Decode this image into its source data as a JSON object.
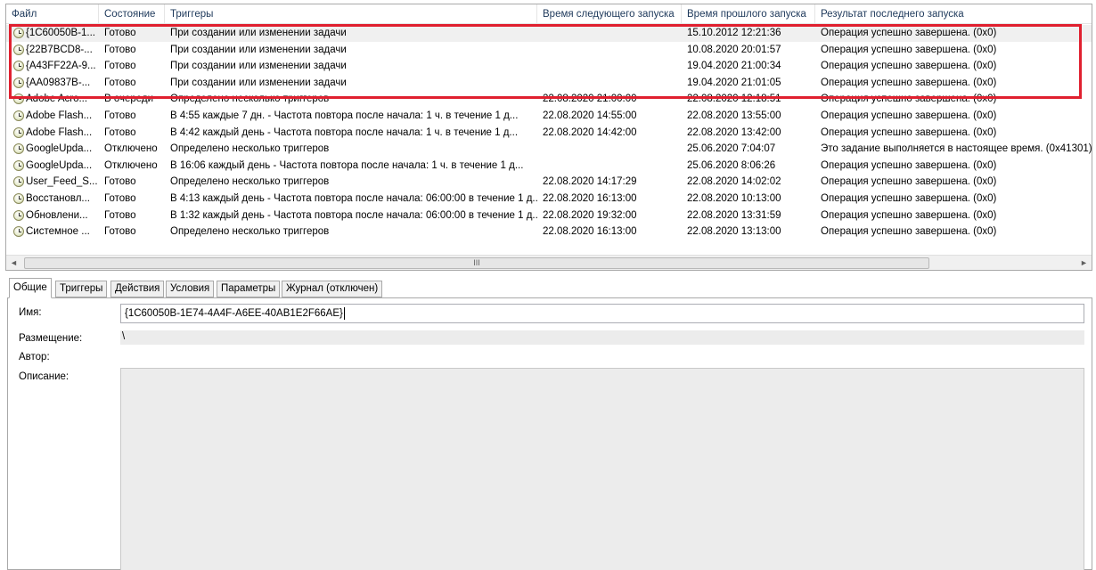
{
  "columns": [
    "Файл",
    "Состояние",
    "Триггеры",
    "Время следующего запуска",
    "Время прошлого запуска",
    "Результат последнего запуска"
  ],
  "tasks": [
    {
      "file": "{1C60050B-1...",
      "state": "Готово",
      "triggers": "При создании или изменении задачи",
      "next_run": "",
      "last_run": "15.10.2012 12:21:36",
      "result": "Операция успешно завершена. (0x0)"
    },
    {
      "file": "{22B7BCD8-...",
      "state": "Готово",
      "triggers": "При создании или изменении задачи",
      "next_run": "",
      "last_run": "10.08.2020 20:01:57",
      "result": "Операция успешно завершена. (0x0)"
    },
    {
      "file": "{A43FF22A-9...",
      "state": "Готово",
      "triggers": "При создании или изменении задачи",
      "next_run": "",
      "last_run": "19.04.2020 21:00:34",
      "result": "Операция успешно завершена. (0x0)"
    },
    {
      "file": "{AA09837B-...",
      "state": "Готово",
      "triggers": "При создании или изменении задачи",
      "next_run": "",
      "last_run": "19.04.2020 21:01:05",
      "result": "Операция успешно завершена. (0x0)"
    },
    {
      "file": "Adobe Acro...",
      "state": "В очереди",
      "triggers": "Определено несколько триггеров",
      "next_run": "22.08.2020 21:00:00",
      "last_run": "22.08.2020 12:18:51",
      "result": "Операция успешно завершена. (0x0)"
    },
    {
      "file": "Adobe Flash...",
      "state": "Готово",
      "triggers": "В 4:55 каждые 7 дн. - Частота повтора после начала: 1 ч. в течение 1 д...",
      "next_run": "22.08.2020 14:55:00",
      "last_run": "22.08.2020 13:55:00",
      "result": "Операция успешно завершена. (0x0)"
    },
    {
      "file": "Adobe Flash...",
      "state": "Готово",
      "triggers": "В 4:42 каждый день - Частота повтора после начала: 1 ч. в течение 1 д...",
      "next_run": "22.08.2020 14:42:00",
      "last_run": "22.08.2020 13:42:00",
      "result": "Операция успешно завершена. (0x0)"
    },
    {
      "file": "GoogleUpda...",
      "state": "Отключено",
      "triggers": "Определено несколько триггеров",
      "next_run": "",
      "last_run": "25.06.2020 7:04:07",
      "result": "Это задание выполняется в настоящее время. (0x41301)"
    },
    {
      "file": "GoogleUpda...",
      "state": "Отключено",
      "triggers": "В 16:06 каждый день - Частота повтора после начала: 1 ч. в течение 1 д...",
      "next_run": "",
      "last_run": "25.06.2020 8:06:26",
      "result": "Операция успешно завершена. (0x0)"
    },
    {
      "file": "User_Feed_S...",
      "state": "Готово",
      "triggers": "Определено несколько триггеров",
      "next_run": "22.08.2020 14:17:29",
      "last_run": "22.08.2020 14:02:02",
      "result": "Операция успешно завершена. (0x0)"
    },
    {
      "file": "Восстановл...",
      "state": "Готово",
      "triggers": "В 4:13 каждый день - Частота повтора после начала: 06:00:00 в течение 1 д...",
      "next_run": "22.08.2020 16:13:00",
      "last_run": "22.08.2020 10:13:00",
      "result": "Операция успешно завершена. (0x0)"
    },
    {
      "file": "Обновлени...",
      "state": "Готово",
      "triggers": "В 1:32 каждый день - Частота повтора после начала: 06:00:00 в течение 1 д...",
      "next_run": "22.08.2020 19:32:00",
      "last_run": "22.08.2020 13:31:59",
      "result": "Операция успешно завершена. (0x0)"
    },
    {
      "file": "Системное ...",
      "state": "Готово",
      "triggers": "Определено несколько триггеров",
      "next_run": "22.08.2020 16:13:00",
      "last_run": "22.08.2020 13:13:00",
      "result": "Операция успешно завершена. (0x0)"
    }
  ],
  "task_icon": "clock-icon",
  "scrollbar": {
    "left_arrow": "◄",
    "right_arrow": "►",
    "grip": "III"
  },
  "highlight_color": "#e0202f",
  "tabs": [
    "Общие",
    "Триггеры",
    "Действия",
    "Условия",
    "Параметры",
    "Журнал (отключен)"
  ],
  "active_tab": "Общие",
  "general": {
    "name_label": "Имя:",
    "name_value": "{1C60050B-1E74-4A4F-A6EE-40AB1E2F66AE}",
    "location_label": "Размещение:",
    "location_value": "\\",
    "author_label": "Автор:",
    "author_value": "",
    "description_label": "Описание:",
    "description_value": ""
  }
}
